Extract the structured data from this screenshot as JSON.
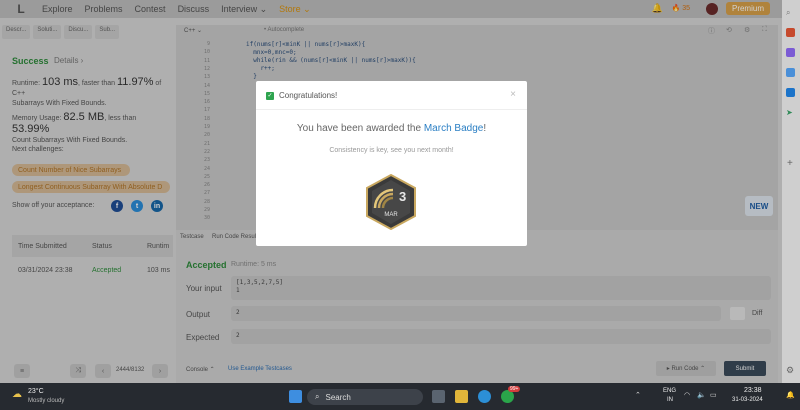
{
  "nav": {
    "logo": "L",
    "explore": "Explore",
    "problems": "Problems",
    "contest": "Contest",
    "discuss": "Discuss",
    "interview": "Interview ⌄",
    "store": "Store ⌄",
    "streak": "35",
    "premium": "Premium"
  },
  "tabs": {
    "left": [
      "Descr...",
      "Soluti...",
      "Discu...",
      "Sub..."
    ],
    "language": "C++",
    "autocomplete": "Autocomplete"
  },
  "result": {
    "status": "Success",
    "details": "Details ›",
    "runtime_prefix": "Runtime: ",
    "runtime_value": "103 ms",
    "runtime_mid": ", faster than ",
    "runtime_pct": "11.97%",
    "runtime_suffix": " of C++",
    "runtime_line2": "Subarrays With Fixed Bounds.",
    "memory_prefix": "Memory Usage: ",
    "memory_value": "82.5 MB",
    "memory_mid": ", less than ",
    "memory_pct": "53.99%",
    "memory_line2": "Count Subarrays With Fixed Bounds.",
    "next_label": "Next challenges:",
    "challenges": [
      "Count Number of Nice Subarrays",
      "Longest Continuous Subarray With Absolute D"
    ],
    "share_label": "Show off your acceptance:",
    "table_headers": [
      "Time Submitted",
      "Status",
      "Runtim"
    ],
    "table_row": [
      "03/31/2024 23:38",
      "Accepted",
      "103 ms"
    ],
    "pager": "2444/8132"
  },
  "editor": {
    "line_numbers": [
      "9",
      "10",
      "11",
      "12",
      "13",
      "14",
      "15",
      "16",
      "17",
      "18",
      "19",
      "20",
      "21",
      "22",
      "23",
      "24",
      "25",
      "26",
      "27",
      "28",
      "29",
      "30"
    ],
    "code": [
      "if(nums[r]<minK || nums[r]>maxK){",
      "  mnx=0,mnc=0;",
      "  while(rin && (nums[r]<minK || nums[r]>maxK)){",
      "    r++;",
      "  }"
    ],
    "new_badge": "NEW"
  },
  "testcase": {
    "tab1": "Testcase",
    "tab2": "Run Code Result",
    "accepted": "Accepted",
    "runtime": "Runtime: 5 ms",
    "input_label": "Your input",
    "input_values": [
      "[1,3,5,2,7,5]",
      "1"
    ],
    "output_label": "Output",
    "output_value": "2",
    "expected_label": "Expected",
    "expected_value": "2",
    "diff": "Diff",
    "console": "Console ⌃",
    "example": "Use Example Testcases",
    "run_code": "▸ Run Code ⌃",
    "submit": "Submit"
  },
  "modal": {
    "header": "Congratulations!",
    "close": "×",
    "title_prefix": "You have been awarded the ",
    "title_badge": "March Badge",
    "title_suffix": "!",
    "subtitle": "Consistency is key, see you next month!",
    "badge_number": "3",
    "badge_month": "MAR"
  },
  "taskbar": {
    "temperature": "23°C",
    "weather": "Mostly cloudy",
    "search": "Search",
    "lang": "ENG",
    "region": "IN",
    "time": "23:38",
    "date": "31-03-2024",
    "notif": "99+"
  },
  "colors": {
    "accent_green": "#2e8a3b",
    "premium": "#d7a04a",
    "link_blue": "#2b7fc4"
  }
}
